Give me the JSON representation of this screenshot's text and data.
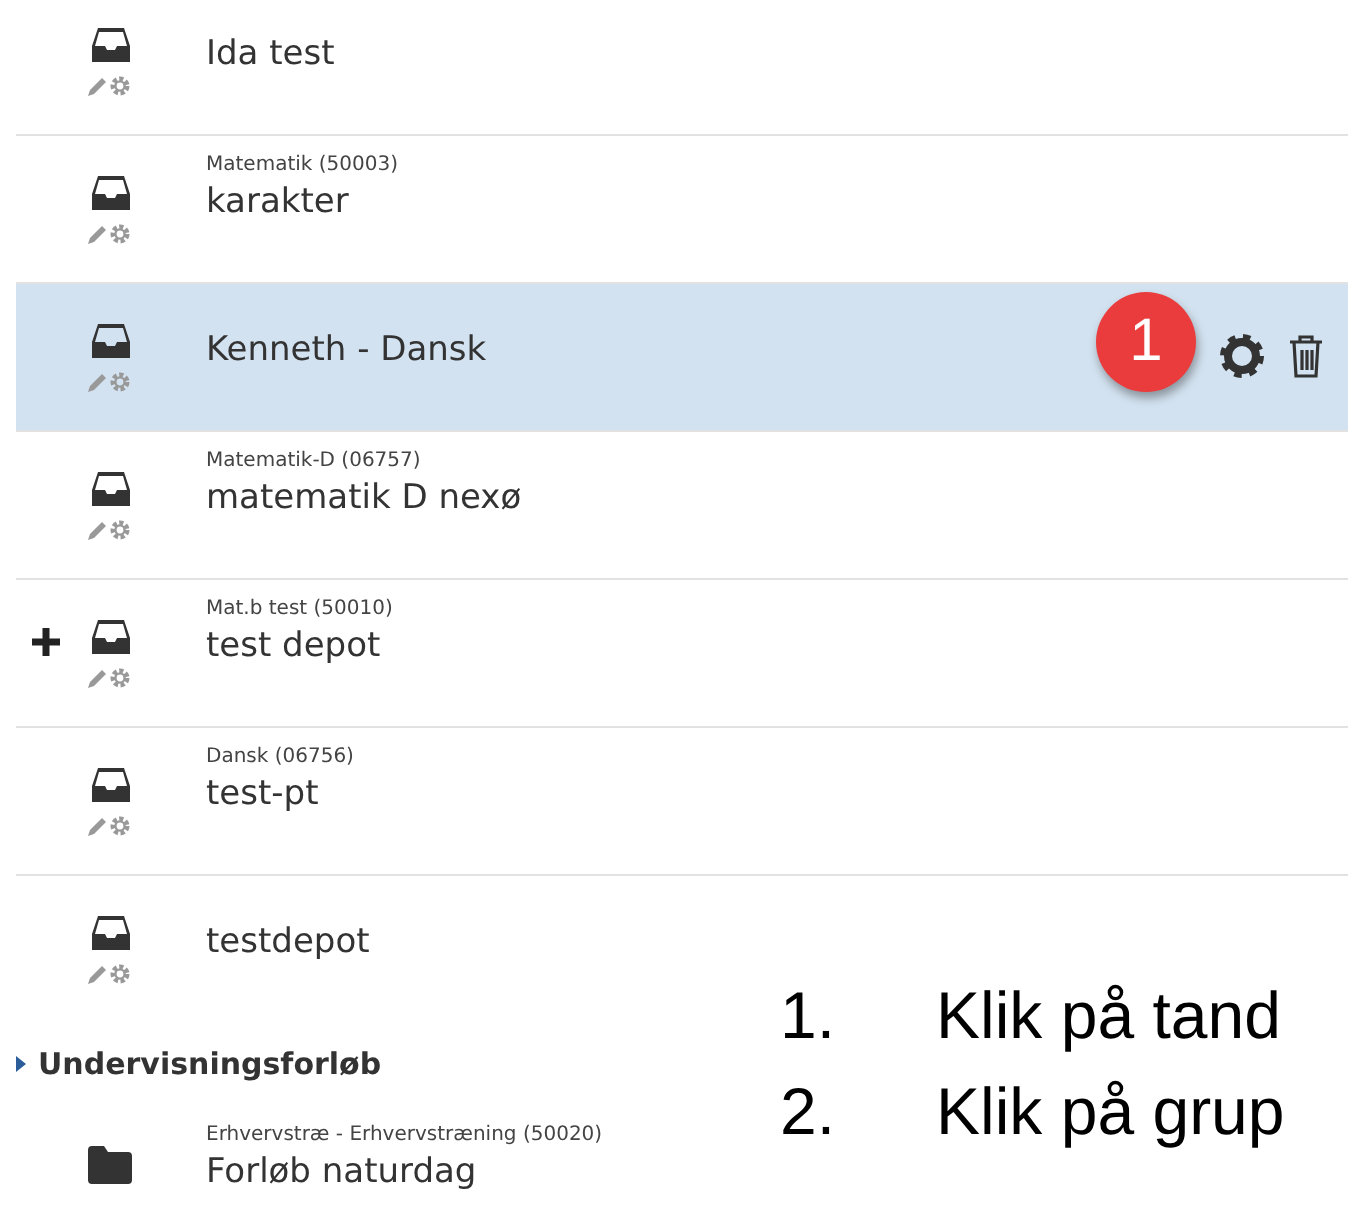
{
  "items": [
    {
      "kind": "depot",
      "title": "Ida test",
      "selected": false,
      "expandable": false
    },
    {
      "kind": "depot",
      "subtitle": "Matematik (50003)",
      "title": "karakter",
      "selected": false,
      "expandable": false
    },
    {
      "kind": "depot",
      "title": "Kenneth - Dansk",
      "selected": true,
      "expandable": false,
      "badge": "1"
    },
    {
      "kind": "depot",
      "subtitle": "Matematik-D (06757)",
      "title": "matematik D nexø",
      "selected": false,
      "expandable": false
    },
    {
      "kind": "depot",
      "subtitle": "Mat.b test (50010)",
      "title": "test depot",
      "selected": false,
      "expandable": true
    },
    {
      "kind": "depot",
      "subtitle": "Dansk (06756)",
      "title": "test-pt",
      "selected": false,
      "expandable": false
    },
    {
      "kind": "depot",
      "title": "testdepot",
      "selected": false,
      "expandable": false
    }
  ],
  "section": {
    "title": "Undervisningsforløb",
    "items": [
      {
        "kind": "folder",
        "subtitle": "Erhvervstræ - Erhvervstræning (50020)",
        "title": "Forløb naturdag",
        "selected": false,
        "expandable": false
      }
    ]
  },
  "steps": [
    {
      "number": "1.",
      "text": "Klik på tand"
    },
    {
      "number": "2.",
      "text": "Klik på grup"
    }
  ]
}
